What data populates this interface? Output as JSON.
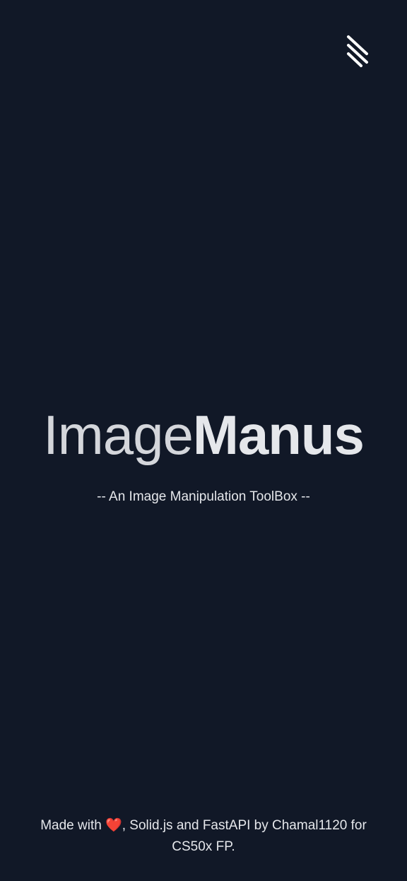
{
  "header": {
    "menu_icon": "menu-slashes-icon"
  },
  "hero": {
    "title_light": "Image",
    "title_bold": "Manus",
    "tagline": "-- An Image Manipulation ToolBox --"
  },
  "footer": {
    "made_with": "Made with ",
    "heart": "❤️",
    "rest_line": ", Solid.js and FastAPI by Chamal1120 for",
    "line2": "CS50x FP."
  },
  "colors": {
    "background": "#111827",
    "text": "#e5e7eb",
    "heart": "#ef4444"
  }
}
